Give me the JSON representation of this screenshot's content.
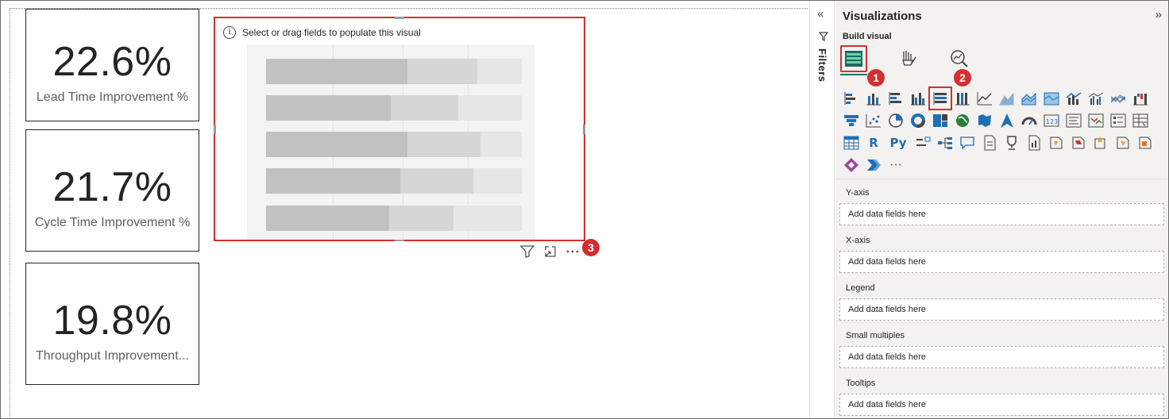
{
  "cards": [
    {
      "value": "22.6%",
      "label": "Lead Time Improvement %"
    },
    {
      "value": "21.7%",
      "label": "Cycle Time Improvement %"
    },
    {
      "value": "19.8%",
      "label": "Throughput Improvement..."
    }
  ],
  "visual": {
    "hint": "Select or drag fields to populate this visual"
  },
  "badges": [
    "1",
    "2",
    "3"
  ],
  "filters": {
    "label": "Filters"
  },
  "visualizations": {
    "title": "Visualizations",
    "build_visual": "Build visual",
    "modes": [
      "build-visual-icon",
      "format-visual-icon",
      "analytics-icon"
    ],
    "text_icons": {
      "r": "R",
      "py": "Py",
      "more": "···"
    }
  },
  "wells": [
    {
      "label": "Y-axis",
      "placeholder": "Add data fields here"
    },
    {
      "label": "X-axis",
      "placeholder": "Add data fields here"
    },
    {
      "label": "Legend",
      "placeholder": "Add data fields here"
    },
    {
      "label": "Small multiples",
      "placeholder": "Add data fields here"
    },
    {
      "label": "Tooltips",
      "placeholder": "Add data fields here"
    }
  ],
  "colors": {
    "accent_red": "#d32f2f",
    "selected_green": "#117865",
    "icon_blue": "#1f6fb5"
  }
}
